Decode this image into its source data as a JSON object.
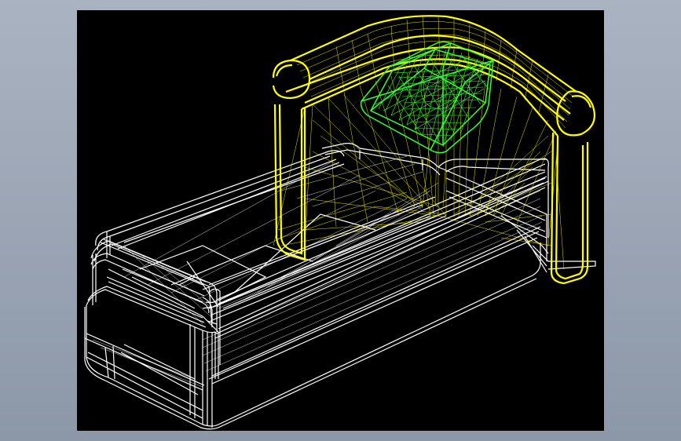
{
  "viewport": {
    "background": "#000000",
    "model": {
      "type": "wireframe",
      "object": "chaise-lounge",
      "parts": [
        {
          "name": "base-frame",
          "color": "#ffffff"
        },
        {
          "name": "seat-cushion",
          "color": "#ffffff"
        },
        {
          "name": "backrest-arm-frame",
          "color": "#ffff00"
        },
        {
          "name": "pillow",
          "color": "#33ff33"
        }
      ]
    }
  },
  "colors": {
    "window_background_top": "#aab3c1",
    "window_background_bottom": "#8c97a8",
    "white_wire": "#ffffff",
    "yellow_wire": "#ffff00",
    "green_wire": "#33ff33"
  }
}
